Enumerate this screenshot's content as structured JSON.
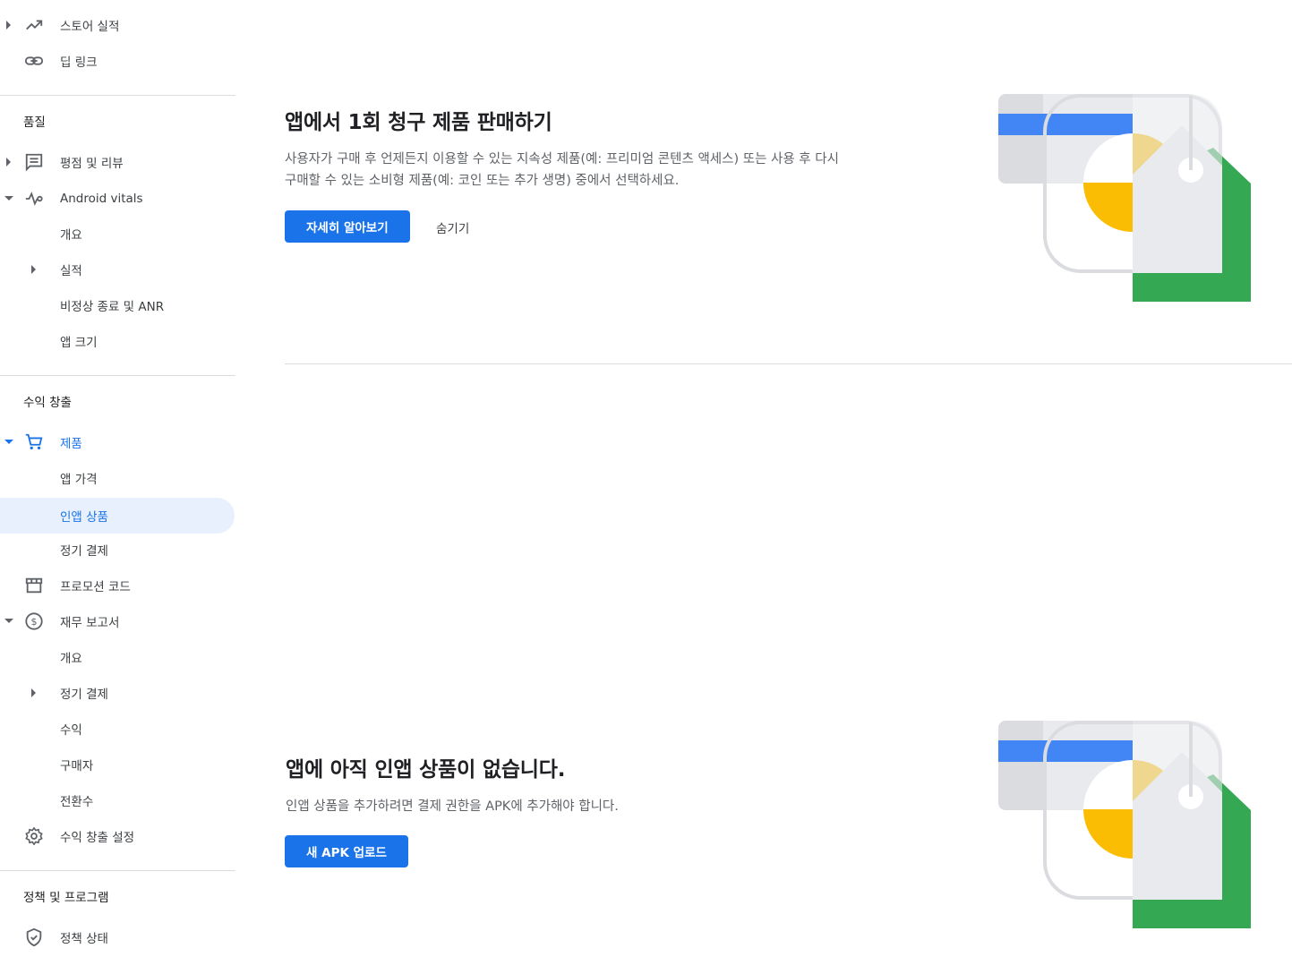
{
  "sidebar": {
    "items": [
      {
        "label": "스토어 실적"
      },
      {
        "label": "딥 링크"
      },
      {
        "section": "품질"
      },
      {
        "label": "평점 및 리뷰"
      },
      {
        "label": "Android vitals"
      },
      {
        "label": "개요"
      },
      {
        "label": "실적"
      },
      {
        "label": "비정상 종료 및 ANR"
      },
      {
        "label": "앱 크기"
      },
      {
        "section": "수익 창출"
      },
      {
        "label": "제품"
      },
      {
        "label": "앱 가격"
      },
      {
        "label": "인앱 상품"
      },
      {
        "label": "정기 결제"
      },
      {
        "label": "프로모션 코드"
      },
      {
        "label": "재무 보고서"
      },
      {
        "label": "개요"
      },
      {
        "label": "정기 결제"
      },
      {
        "label": "수익"
      },
      {
        "label": "구매자"
      },
      {
        "label": "전환수"
      },
      {
        "label": "수익 창출 설정"
      },
      {
        "section": "정책 및 프로그램"
      },
      {
        "label": "정책 상태"
      }
    ]
  },
  "promo_card": {
    "title": "앱에서 1회 청구 제품 판매하기",
    "description": "사용자가 구매 후 언제든지 이용할 수 있는 지속성 제품(예: 프리미엄 콘텐츠 액세스) 또는 사용 후 다시 구매할 수 있는 소비형 제품(예: 코인 또는 추가 생명) 중에서 선택하세요.",
    "learn_more_label": "자세히 알아보기",
    "hide_label": "숨기기"
  },
  "empty_state": {
    "title": "앱에 아직 인앱 상품이 없습니다.",
    "description": "인앱 상품을 추가하려면 결제 권한을 APK에 추가해야 합니다.",
    "upload_label": "새 APK 업로드"
  },
  "colors": {
    "accent": "#1a73e8",
    "active_bg": "#e8f0fe",
    "illus_blue": "#4285f4",
    "illus_yellow": "#fbbc04",
    "illus_green": "#34a853",
    "illus_grey": "#dadce0"
  }
}
